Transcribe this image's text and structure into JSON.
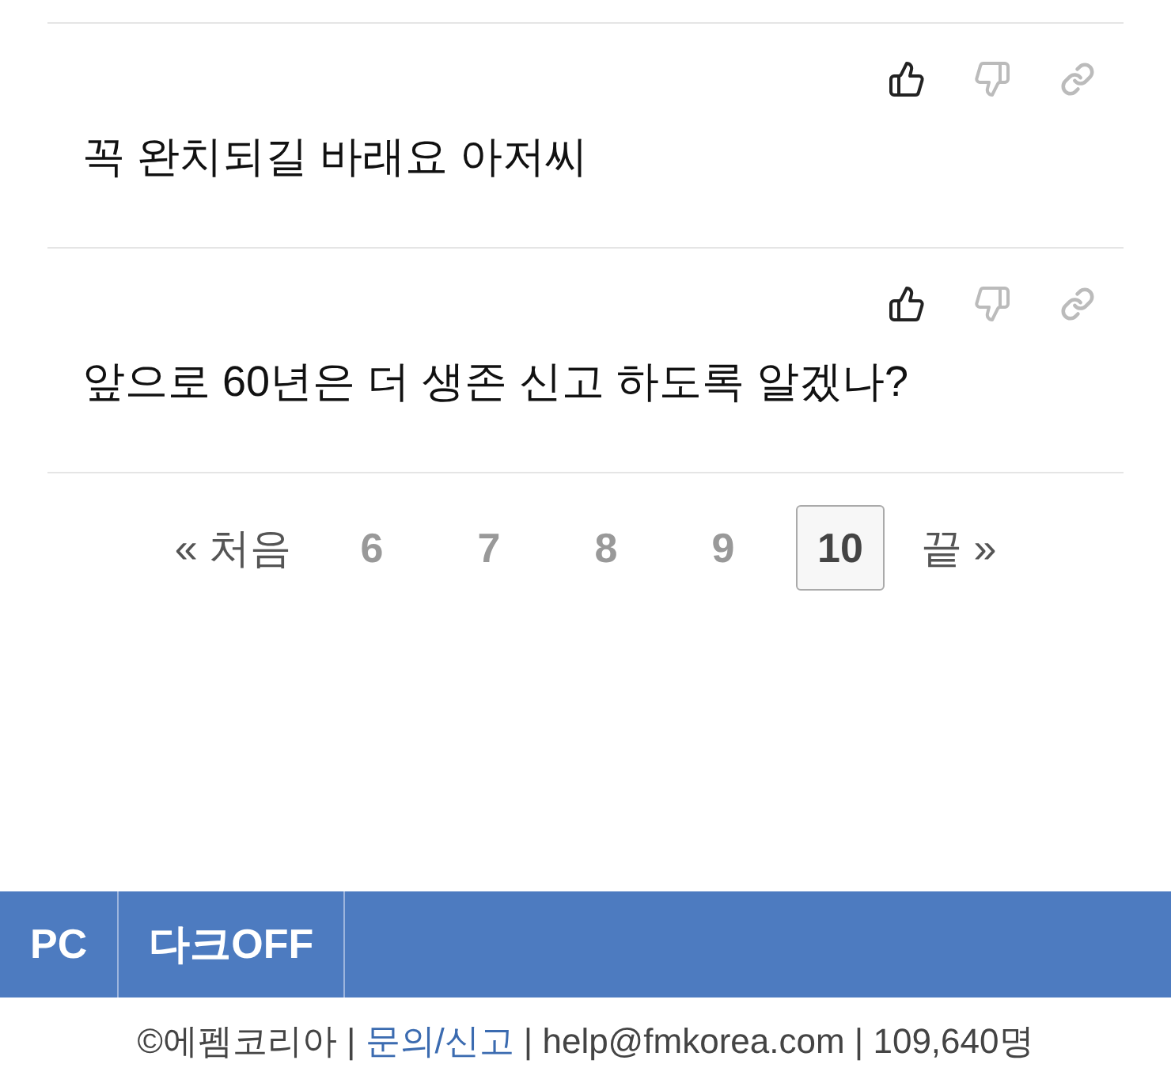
{
  "comments": [
    {
      "text": "꼭 완치되길 바래요 아저씨"
    },
    {
      "text": "앞으로 60년은 더 생존 신고 하도록 알겠나?"
    }
  ],
  "pagination": [
    {
      "label": "« 처음",
      "kind": "edge",
      "selected": false
    },
    {
      "label": "6",
      "kind": "page",
      "selected": false
    },
    {
      "label": "7",
      "kind": "page",
      "selected": false
    },
    {
      "label": "8",
      "kind": "page",
      "selected": false
    },
    {
      "label": "9",
      "kind": "page",
      "selected": false
    },
    {
      "label": "10",
      "kind": "page",
      "selected": true
    },
    {
      "label": "끝 »",
      "kind": "edge",
      "selected": false
    }
  ],
  "bottom_bar": [
    "PC",
    "다크OFF"
  ],
  "footer": [
    {
      "kind": "text",
      "text": "©에펨코리아 |"
    },
    {
      "kind": "link",
      "text": "문의/신고"
    },
    {
      "kind": "text",
      "text": "| help@fmkorea.com | 109,640명"
    }
  ]
}
